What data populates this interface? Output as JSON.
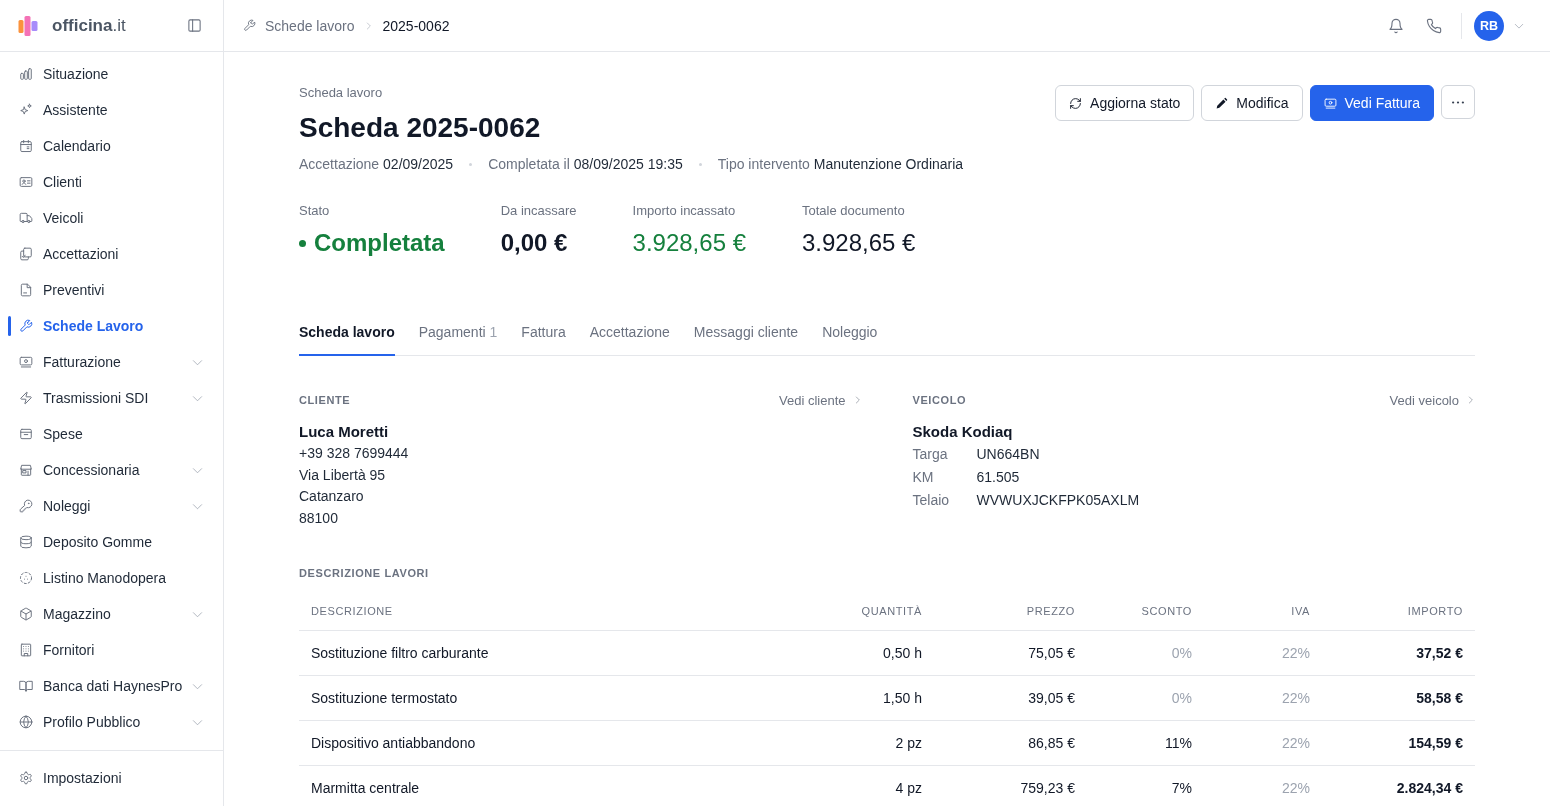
{
  "brand": {
    "name": "**officina**.it"
  },
  "sidebar": {
    "items": [
      {
        "label": "Situazione",
        "selected": false,
        "expandable": false
      },
      {
        "label": "Assistente",
        "selected": false,
        "expandable": false
      },
      {
        "label": "Calendario",
        "selected": false,
        "expandable": false
      },
      {
        "label": "Clienti",
        "selected": false,
        "expandable": false
      },
      {
        "label": "Veicoli",
        "selected": false,
        "expandable": false
      },
      {
        "label": "Accettazioni",
        "selected": false,
        "expandable": false
      },
      {
        "label": "Preventivi",
        "selected": false,
        "expandable": false
      },
      {
        "label": "Schede Lavoro",
        "selected": true,
        "expandable": false
      },
      {
        "label": "Fatturazione",
        "selected": false,
        "expandable": true
      },
      {
        "label": "Trasmissioni SDI",
        "selected": false,
        "expandable": true
      },
      {
        "label": "Spese",
        "selected": false,
        "expandable": false
      },
      {
        "label": "Concessionaria",
        "selected": false,
        "expandable": true
      },
      {
        "label": "Noleggi",
        "selected": false,
        "expandable": true
      },
      {
        "label": "Deposito Gomme",
        "selected": false,
        "expandable": false
      },
      {
        "label": "Listino Manodopera",
        "selected": false,
        "expandable": false
      },
      {
        "label": "Magazzino",
        "selected": false,
        "expandable": true
      },
      {
        "label": "Fornitori",
        "selected": false,
        "expandable": false
      },
      {
        "label": "Banca dati HaynesPro",
        "selected": false,
        "expandable": true
      },
      {
        "label": "Profilo Pubblico",
        "selected": false,
        "expandable": true
      }
    ],
    "footer_items": [
      {
        "label": "Impostazioni",
        "selected": false
      }
    ]
  },
  "breadcrumb": [
    "Schede lavoro",
    "2025-0062"
  ],
  "user": {
    "initials": "RB"
  },
  "page": {
    "eyebrow": "Scheda lavoro",
    "title": "Scheda 2025-0062",
    "meta": [
      {
        "label": "Accettazione",
        "value": "02/09/2025"
      },
      {
        "label": "Completata il",
        "value": "08/09/2025 19:35"
      },
      {
        "label": "Tipo intervento",
        "value": "Manutenzione Ordinaria"
      }
    ],
    "actions": [
      {
        "label": "Aggiorna stato",
        "kind": "secondary"
      },
      {
        "label": "Modifica",
        "kind": "secondary"
      },
      {
        "label": "Vedi Fattura",
        "kind": "primary"
      },
      {
        "kind": "more"
      }
    ]
  },
  "stats": [
    {
      "label": "Stato",
      "value": "Completata",
      "kind": "status",
      "color": "#15803d",
      "emphasized": true
    },
    {
      "label": "Da incassare",
      "value": "0,00 €",
      "kind": "amount",
      "color": "#111827",
      "emphasized": true
    },
    {
      "label": "Importo incassato",
      "value": "3.928,65 €",
      "kind": "amount",
      "color": "#15803d",
      "emphasized": false
    },
    {
      "label": "Totale documento",
      "value": "3.928,65 €",
      "kind": "amount",
      "color": "#111827",
      "emphasized": false
    }
  ],
  "tabs": [
    {
      "label": "Scheda lavoro",
      "selected": true
    },
    {
      "label": "Pagamenti",
      "count": "1",
      "selected": false
    },
    {
      "label": "Fattura",
      "selected": false
    },
    {
      "label": "Accettazione",
      "selected": false
    },
    {
      "label": "Messaggi cliente",
      "selected": false
    },
    {
      "label": "Noleggio",
      "selected": false
    }
  ],
  "client": {
    "heading": "CLIENTE",
    "link": "Vedi cliente",
    "name": "Luca Moretti",
    "lines": [
      "+39 328 7699444",
      "Via Libertà 95",
      "Catanzaro",
      "88100"
    ]
  },
  "vehicle": {
    "heading": "VEICOLO",
    "link": "Vedi veicolo",
    "name": "Skoda Kodiaq",
    "fields": [
      {
        "label": "Targa",
        "value": "UN664BN"
      },
      {
        "label": "KM",
        "value": "61.505"
      },
      {
        "label": "Telaio",
        "value": "WVWUXJCKFPK05AXLM"
      }
    ]
  },
  "work_table": {
    "heading": "DESCRIZIONE LAVORI",
    "columns": [
      "DESCRIZIONE",
      "QUANTITÀ",
      "PREZZO",
      "SCONTO",
      "IVA",
      "IMPORTO"
    ],
    "rows": [
      {
        "cells": [
          "Sostituzione filtro carburante",
          "0,50 h",
          "75,05 €",
          "0%",
          "22%",
          "37,52 €"
        ],
        "discount_applied": false
      },
      {
        "cells": [
          "Sostituzione termostato",
          "1,50 h",
          "39,05 €",
          "0%",
          "22%",
          "58,58 €"
        ],
        "discount_applied": false
      },
      {
        "cells": [
          "Dispositivo antiabbandono",
          "2 pz",
          "86,85 €",
          "11%",
          "22%",
          "154,59 €"
        ],
        "discount_applied": true
      },
      {
        "cells": [
          "Marmitta centrale",
          "4 pz",
          "759,23 €",
          "7%",
          "22%",
          "2.824,34 €"
        ],
        "discount_applied": true
      }
    ]
  }
}
